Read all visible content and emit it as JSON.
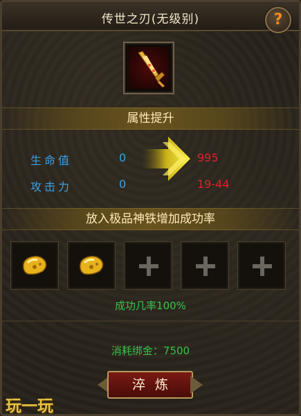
{
  "window": {
    "title": "传世之刃(无级别)",
    "help_label": "?"
  },
  "item": {
    "icon": "sword-icon"
  },
  "sections": {
    "attribute_title": "属性提升",
    "material_title": "放入极品神铁增加成功率"
  },
  "stats": [
    {
      "label": "生命值",
      "current": "0",
      "after": "995"
    },
    {
      "label": "攻击力",
      "current": "0",
      "after": "19-44"
    }
  ],
  "slots": [
    {
      "state": "filled",
      "icon": "gold-ore-icon"
    },
    {
      "state": "filled",
      "icon": "gold-ore-icon"
    },
    {
      "state": "empty",
      "icon": "plus-icon"
    },
    {
      "state": "empty",
      "icon": "plus-icon"
    },
    {
      "state": "empty",
      "icon": "plus-icon"
    }
  ],
  "success_rate_text": "成功几率100%",
  "cost_text": "消耗绑金：7500",
  "refine_button": "淬炼",
  "watermark": "玩一玩",
  "colors": {
    "stat_label": "#3aa0e6",
    "stat_after": "#e0202a",
    "green_text": "#36c24a",
    "title_text": "#f2e7c8"
  }
}
